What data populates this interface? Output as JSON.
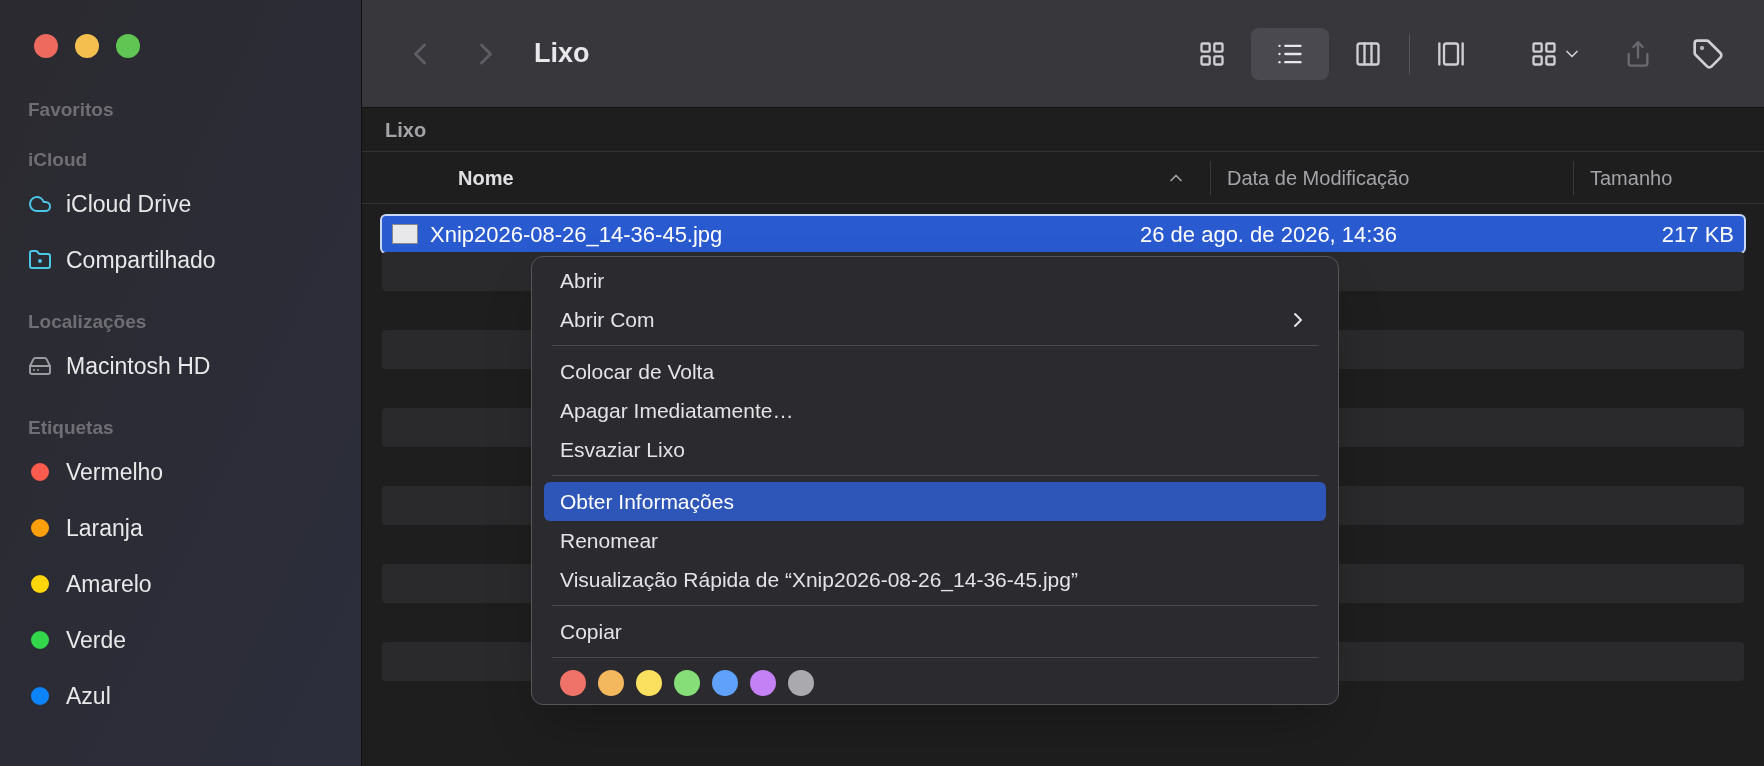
{
  "sidebar": {
    "sections": [
      {
        "title": "Favoritos"
      },
      {
        "title": "iCloud",
        "items": [
          {
            "label": "iCloud Drive",
            "kind": "cloud"
          },
          {
            "label": "Compartilhado",
            "kind": "shared"
          }
        ]
      },
      {
        "title": "Localizações",
        "items": [
          {
            "label": "Macintosh HD",
            "kind": "disk"
          }
        ]
      },
      {
        "title": "Etiquetas",
        "items": [
          {
            "label": "Vermelho",
            "kind": "tag",
            "color": "#ff5a4e"
          },
          {
            "label": "Laranja",
            "kind": "tag",
            "color": "#ff9f0a"
          },
          {
            "label": "Amarelo",
            "kind": "tag",
            "color": "#ffd60a"
          },
          {
            "label": "Verde",
            "kind": "tag",
            "color": "#32d74b"
          },
          {
            "label": "Azul",
            "kind": "tag",
            "color": "#0a84ff"
          }
        ]
      }
    ]
  },
  "toolbar": {
    "title": "Lixo",
    "views": [
      {
        "kind": "icons",
        "selected": false
      },
      {
        "kind": "list",
        "selected": true
      },
      {
        "kind": "columns",
        "selected": false
      },
      {
        "kind": "gallery",
        "selected": false
      }
    ]
  },
  "path_bar": "Lixo",
  "table": {
    "columns": [
      {
        "label": "Nome",
        "sorted": true
      },
      {
        "label": "Data de Modificação",
        "sorted": false
      },
      {
        "label": "Tamanho",
        "sorted": false
      }
    ],
    "rows": [
      {
        "name": "Xnip2026-08-26_14-36-45.jpg",
        "date": "26 de ago. de 2026, 14:36",
        "size": "217 KB",
        "selected": true
      }
    ]
  },
  "context_menu": {
    "items": [
      {
        "kind": "item",
        "label": "Abrir",
        "selected": false,
        "submenu": false
      },
      {
        "kind": "item",
        "label": "Abrir Com",
        "selected": false,
        "submenu": true
      },
      {
        "kind": "separator"
      },
      {
        "kind": "item",
        "label": "Colocar de Volta",
        "selected": false,
        "submenu": false
      },
      {
        "kind": "item",
        "label": "Apagar Imediatamente…",
        "selected": false,
        "submenu": false
      },
      {
        "kind": "item",
        "label": "Esvaziar Lixo",
        "selected": false,
        "submenu": false
      },
      {
        "kind": "separator"
      },
      {
        "kind": "item",
        "label": "Obter Informações",
        "selected": true,
        "submenu": false
      },
      {
        "kind": "item",
        "label": "Renomear",
        "selected": false,
        "submenu": false
      },
      {
        "kind": "item",
        "label": "Visualização Rápida de “Xnip2026-08-26_14-36-45.jpg”",
        "selected": false,
        "submenu": false
      },
      {
        "kind": "separator"
      },
      {
        "kind": "item",
        "label": "Copiar",
        "selected": false,
        "submenu": false
      },
      {
        "kind": "separator"
      }
    ],
    "tags": [
      {
        "color": "#ef7368"
      },
      {
        "color": "#f3b75e"
      },
      {
        "color": "#fbe05f"
      },
      {
        "color": "#86de78"
      },
      {
        "color": "#5fa1fb"
      },
      {
        "color": "#c481f5"
      },
      {
        "color": "#a9a9ae"
      }
    ]
  }
}
